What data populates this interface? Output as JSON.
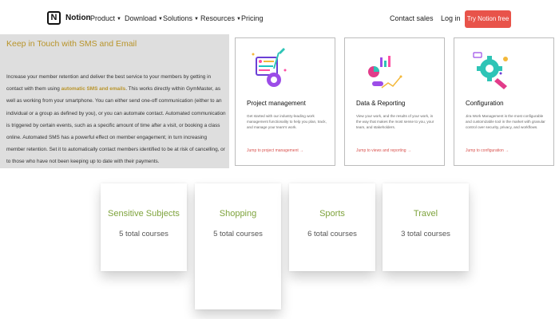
{
  "nav": {
    "logo_glyph": "N",
    "logo_text": "Notion",
    "items": [
      {
        "label": "Product",
        "chevron": "chevron-down-icon"
      },
      {
        "label": "Download",
        "chevron": "chevron-down-icon"
      },
      {
        "label": "Solutions",
        "chevron": "chevron-down-icon"
      },
      {
        "label": "Resources",
        "chevron": "chevron-down-icon"
      },
      {
        "label": "Pricing"
      }
    ],
    "contact_sales": "Contact sales",
    "login": "Log in",
    "cta": "Try Notion free",
    "cta_color": "#e8534a"
  },
  "intro": {
    "heading": "Keep in Touch with SMS and Email",
    "text_before": "Increase your member retention and deliver the best service to your members by getting in contact with them using ",
    "highlight": "automatic SMS and emails",
    "text_after": ". This works directly within GymMaster, as well as working from your smartphone. You can either send one-off communication (either to an individual or a group as defined by you), or you can automate contact. Automated communication is triggered by certain events, such as a specific amount of time after a visit, or booking a class online. Automated SMS has a powerful effect on member engagement; in turn increasing member retention. Set it to automatically contact members identified to be at risk of cancelling, or to those who have not been keeping up to date with their payments.",
    "heading_color": "#b8942a"
  },
  "features": [
    {
      "title": "Project management",
      "desc": "Get started with our industry-leading work management functionality to help you plan, track, and manage your team's work.",
      "link": "Jump to project management →",
      "icon": "project-management-illustration"
    },
    {
      "title": "Data & Reporting",
      "desc": "View your work, and the results of your work, in the way that makes the most sense to you, your team, and stakeholders.",
      "link": "Jump to views and reporting →",
      "icon": "data-reporting-illustration"
    },
    {
      "title": "Configuration",
      "desc": "Jira Work Management is the most configurable and customizable tool in the market with granular control over security, privacy, and workflows.",
      "link": "Jump to configuration →",
      "icon": "configuration-illustration"
    }
  ],
  "courses": [
    {
      "name": "Sensitive Subjects",
      "count": "5 total courses"
    },
    {
      "name": "Shopping",
      "count": "5 total courses"
    },
    {
      "name": "Sports",
      "count": "6 total courses"
    },
    {
      "name": "Travel",
      "count": "3 total courses"
    }
  ],
  "colors": {
    "course_title": "#7ea33c",
    "link": "#d9534f"
  }
}
